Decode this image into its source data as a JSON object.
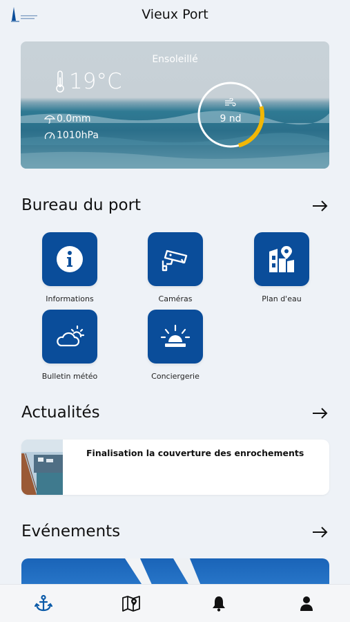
{
  "header": {
    "title": "Vieux Port"
  },
  "weather": {
    "condition": "Ensoleillé",
    "temperature": "19°C",
    "rain": "0.0mm",
    "pressure": "1010hPa",
    "wind": "9 nd",
    "wind_gauge_fraction": 0.25
  },
  "bureau": {
    "title": "Bureau du port",
    "tiles": [
      {
        "label": "Informations",
        "icon": "info-icon"
      },
      {
        "label": "Caméras",
        "icon": "camera-icon"
      },
      {
        "label": "Plan d'eau",
        "icon": "map-pin-icon"
      },
      {
        "label": "Bulletin météo",
        "icon": "weather-icon"
      },
      {
        "label": "Conciergerie",
        "icon": "siren-icon"
      }
    ]
  },
  "news": {
    "title": "Actualités",
    "items": [
      {
        "title": "Finalisation la couverture des enrochements"
      }
    ]
  },
  "events": {
    "title": "Evénements"
  },
  "nav": {
    "items": [
      {
        "icon": "anchor-icon",
        "active": true
      },
      {
        "icon": "map-icon",
        "active": false
      },
      {
        "icon": "bell-icon",
        "active": false
      },
      {
        "icon": "user-icon",
        "active": false
      }
    ]
  },
  "colors": {
    "accent": "#0a4d9a",
    "gauge": "#f2b705"
  }
}
